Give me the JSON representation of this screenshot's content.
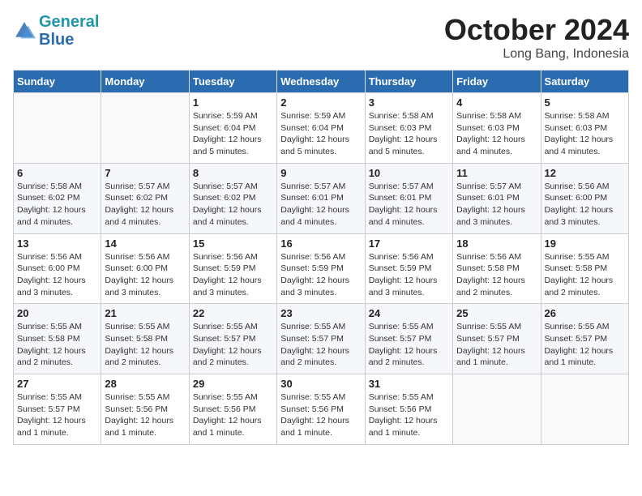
{
  "logo": {
    "line1": "General",
    "line2": "Blue"
  },
  "title": "October 2024",
  "location": "Long Bang, Indonesia",
  "days_of_week": [
    "Sunday",
    "Monday",
    "Tuesday",
    "Wednesday",
    "Thursday",
    "Friday",
    "Saturday"
  ],
  "weeks": [
    [
      {
        "num": "",
        "info": ""
      },
      {
        "num": "",
        "info": ""
      },
      {
        "num": "1",
        "info": "Sunrise: 5:59 AM\nSunset: 6:04 PM\nDaylight: 12 hours\nand 5 minutes."
      },
      {
        "num": "2",
        "info": "Sunrise: 5:59 AM\nSunset: 6:04 PM\nDaylight: 12 hours\nand 5 minutes."
      },
      {
        "num": "3",
        "info": "Sunrise: 5:58 AM\nSunset: 6:03 PM\nDaylight: 12 hours\nand 5 minutes."
      },
      {
        "num": "4",
        "info": "Sunrise: 5:58 AM\nSunset: 6:03 PM\nDaylight: 12 hours\nand 4 minutes."
      },
      {
        "num": "5",
        "info": "Sunrise: 5:58 AM\nSunset: 6:03 PM\nDaylight: 12 hours\nand 4 minutes."
      }
    ],
    [
      {
        "num": "6",
        "info": "Sunrise: 5:58 AM\nSunset: 6:02 PM\nDaylight: 12 hours\nand 4 minutes."
      },
      {
        "num": "7",
        "info": "Sunrise: 5:57 AM\nSunset: 6:02 PM\nDaylight: 12 hours\nand 4 minutes."
      },
      {
        "num": "8",
        "info": "Sunrise: 5:57 AM\nSunset: 6:02 PM\nDaylight: 12 hours\nand 4 minutes."
      },
      {
        "num": "9",
        "info": "Sunrise: 5:57 AM\nSunset: 6:01 PM\nDaylight: 12 hours\nand 4 minutes."
      },
      {
        "num": "10",
        "info": "Sunrise: 5:57 AM\nSunset: 6:01 PM\nDaylight: 12 hours\nand 4 minutes."
      },
      {
        "num": "11",
        "info": "Sunrise: 5:57 AM\nSunset: 6:01 PM\nDaylight: 12 hours\nand 3 minutes."
      },
      {
        "num": "12",
        "info": "Sunrise: 5:56 AM\nSunset: 6:00 PM\nDaylight: 12 hours\nand 3 minutes."
      }
    ],
    [
      {
        "num": "13",
        "info": "Sunrise: 5:56 AM\nSunset: 6:00 PM\nDaylight: 12 hours\nand 3 minutes."
      },
      {
        "num": "14",
        "info": "Sunrise: 5:56 AM\nSunset: 6:00 PM\nDaylight: 12 hours\nand 3 minutes."
      },
      {
        "num": "15",
        "info": "Sunrise: 5:56 AM\nSunset: 5:59 PM\nDaylight: 12 hours\nand 3 minutes."
      },
      {
        "num": "16",
        "info": "Sunrise: 5:56 AM\nSunset: 5:59 PM\nDaylight: 12 hours\nand 3 minutes."
      },
      {
        "num": "17",
        "info": "Sunrise: 5:56 AM\nSunset: 5:59 PM\nDaylight: 12 hours\nand 3 minutes."
      },
      {
        "num": "18",
        "info": "Sunrise: 5:56 AM\nSunset: 5:58 PM\nDaylight: 12 hours\nand 2 minutes."
      },
      {
        "num": "19",
        "info": "Sunrise: 5:55 AM\nSunset: 5:58 PM\nDaylight: 12 hours\nand 2 minutes."
      }
    ],
    [
      {
        "num": "20",
        "info": "Sunrise: 5:55 AM\nSunset: 5:58 PM\nDaylight: 12 hours\nand 2 minutes."
      },
      {
        "num": "21",
        "info": "Sunrise: 5:55 AM\nSunset: 5:58 PM\nDaylight: 12 hours\nand 2 minutes."
      },
      {
        "num": "22",
        "info": "Sunrise: 5:55 AM\nSunset: 5:57 PM\nDaylight: 12 hours\nand 2 minutes."
      },
      {
        "num": "23",
        "info": "Sunrise: 5:55 AM\nSunset: 5:57 PM\nDaylight: 12 hours\nand 2 minutes."
      },
      {
        "num": "24",
        "info": "Sunrise: 5:55 AM\nSunset: 5:57 PM\nDaylight: 12 hours\nand 2 minutes."
      },
      {
        "num": "25",
        "info": "Sunrise: 5:55 AM\nSunset: 5:57 PM\nDaylight: 12 hours\nand 1 minute."
      },
      {
        "num": "26",
        "info": "Sunrise: 5:55 AM\nSunset: 5:57 PM\nDaylight: 12 hours\nand 1 minute."
      }
    ],
    [
      {
        "num": "27",
        "info": "Sunrise: 5:55 AM\nSunset: 5:57 PM\nDaylight: 12 hours\nand 1 minute."
      },
      {
        "num": "28",
        "info": "Sunrise: 5:55 AM\nSunset: 5:56 PM\nDaylight: 12 hours\nand 1 minute."
      },
      {
        "num": "29",
        "info": "Sunrise: 5:55 AM\nSunset: 5:56 PM\nDaylight: 12 hours\nand 1 minute."
      },
      {
        "num": "30",
        "info": "Sunrise: 5:55 AM\nSunset: 5:56 PM\nDaylight: 12 hours\nand 1 minute."
      },
      {
        "num": "31",
        "info": "Sunrise: 5:55 AM\nSunset: 5:56 PM\nDaylight: 12 hours\nand 1 minute."
      },
      {
        "num": "",
        "info": ""
      },
      {
        "num": "",
        "info": ""
      }
    ]
  ]
}
